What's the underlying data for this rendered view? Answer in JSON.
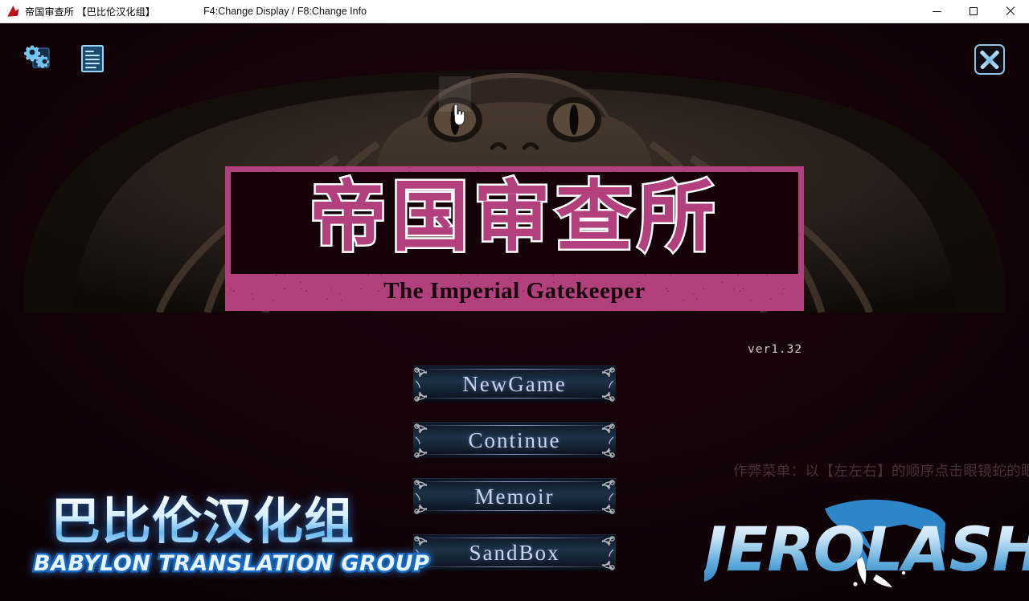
{
  "window": {
    "app_icon": "app-logo-icon",
    "title": "帝国审查所 【巴比伦汉化组】",
    "hint": "F4:Change Display / F8:Change Info",
    "controls": {
      "minimize": "minimize-icon",
      "maximize": "maximize-icon",
      "close": "close-icon"
    }
  },
  "game": {
    "icons": [
      {
        "name": "settings-gears-icon",
        "label": "Settings"
      },
      {
        "name": "log-document-icon",
        "label": "Log"
      }
    ],
    "close_button": "close-x-icon",
    "title_plate": {
      "chinese": "帝国审查所",
      "english": "The Imperial Gatekeeper",
      "band_color": "#b2407d",
      "inner_color": "#150108"
    },
    "version": "ver1.32",
    "menu": [
      {
        "label": "NewGame"
      },
      {
        "label": "Continue"
      },
      {
        "label": "Memoir"
      },
      {
        "label": "SandBox"
      }
    ],
    "cheat_hint": "作弊菜单：以【左左右】的顺序点击眼镜蛇的眼睛",
    "babylon_logo": {
      "chinese": "巴比伦汉化组",
      "english": "BABYLON TRANSLATION GROUP"
    },
    "jerolash_logo": "JEROLASH",
    "background_art": "cobra-snake-head",
    "cursor": "hand-pointer-cursor",
    "eye_highlight": "snake-left-eye-hotspot"
  },
  "colors": {
    "background": "#150309",
    "accent_pink": "#b2407d",
    "button_text": "#cdd6ef",
    "icon_blue": "#8fc4e6"
  }
}
